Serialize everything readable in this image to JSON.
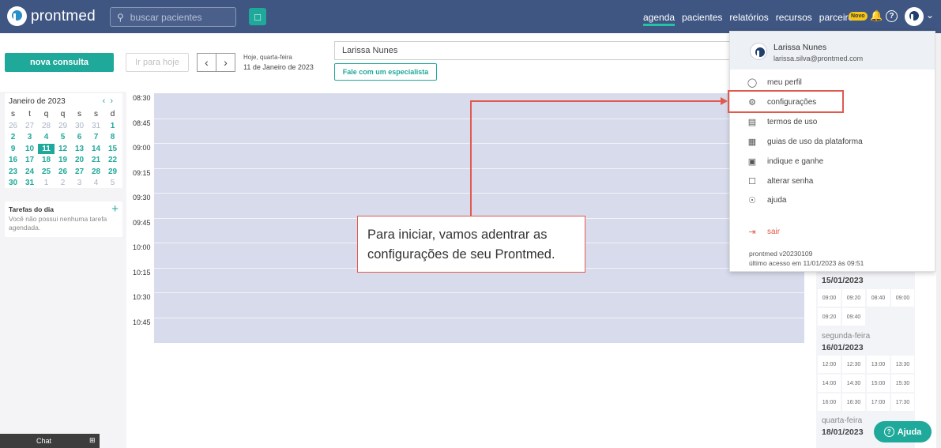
{
  "brand": {
    "name": "prontmed"
  },
  "search": {
    "placeholder": "buscar pacientes"
  },
  "nav": {
    "items": [
      "agenda",
      "pacientes",
      "relatórios",
      "recursos",
      "parceiros"
    ],
    "active": "agenda",
    "badge": "Novo"
  },
  "toolbar": {
    "nova_consulta": "nova consulta",
    "ir_para_hoje": "Ir para hoje",
    "today_label": "Hoje, quarta-feira",
    "today_date": "11 de Janeiro de 2023",
    "doctor": "Larissa Nunes",
    "fale": "Fale com um especialista"
  },
  "calendar": {
    "title": "Janeiro de 2023",
    "weekdays": [
      "s",
      "t",
      "q",
      "q",
      "s",
      "s",
      "d"
    ],
    "weeks": [
      [
        "26",
        "27",
        "28",
        "29",
        "30",
        "31",
        "1"
      ],
      [
        "2",
        "3",
        "4",
        "5",
        "6",
        "7",
        "8"
      ],
      [
        "9",
        "10",
        "11",
        "12",
        "13",
        "14",
        "15"
      ],
      [
        "16",
        "17",
        "18",
        "19",
        "20",
        "21",
        "22"
      ],
      [
        "23",
        "24",
        "25",
        "26",
        "27",
        "28",
        "29"
      ],
      [
        "30",
        "31",
        "1",
        "2",
        "3",
        "4",
        "5"
      ]
    ],
    "selected": "11"
  },
  "tasks": {
    "title": "Tarefas do dia",
    "empty": "Você não possui nenhuma tarefa agendada."
  },
  "chat": {
    "label": "Chat"
  },
  "schedule": {
    "times": [
      "08:30",
      "08:45",
      "09:00",
      "09:15",
      "09:30",
      "09:45",
      "10:00",
      "10:15",
      "10:30",
      "10:45"
    ]
  },
  "availability": [
    {
      "day_name": "",
      "date": "15/01/2023",
      "slots": [
        "09:00",
        "09:20",
        "08:40",
        "09:00",
        "09:20",
        "09:40"
      ]
    },
    {
      "day_name": "segunda-feira",
      "date": "16/01/2023",
      "slots": [
        "12:00",
        "12:30",
        "13:00",
        "13:30",
        "14:00",
        "14:30",
        "15:00",
        "15:30",
        "16:00",
        "16:30",
        "17:00",
        "17:30"
      ]
    },
    {
      "day_name": "quarta-feira",
      "date": "18/01/2023",
      "slots": []
    }
  ],
  "user_menu": {
    "name": "Larissa Nunes",
    "email": "larissa.silva@prontmed.com",
    "items": [
      {
        "label": "meu perfil",
        "icon": "user-icon"
      },
      {
        "label": "configurações",
        "icon": "gear-icon"
      },
      {
        "label": "termos de uso",
        "icon": "document-icon"
      },
      {
        "label": "guias de uso da plataforma",
        "icon": "book-icon"
      },
      {
        "label": "indique e ganhe",
        "icon": "gift-icon"
      },
      {
        "label": "alterar senha",
        "icon": "lock-icon"
      },
      {
        "label": "ajuda",
        "icon": "support-icon"
      }
    ],
    "logout": "sair",
    "version": "prontmed v20230109",
    "last_access": "último acesso em 11/01/2023 às 09:51"
  },
  "tutorial": {
    "callout": "Para iniciar, vamos adentrar as configurações de seu Prontmed.",
    "highlight_color": "#e05a4f"
  },
  "help_button": {
    "label": "Ajuda"
  },
  "colors": {
    "topbar": "#3f5682",
    "accent": "#1fa99a",
    "schedule_bg": "#d8dbeb"
  }
}
